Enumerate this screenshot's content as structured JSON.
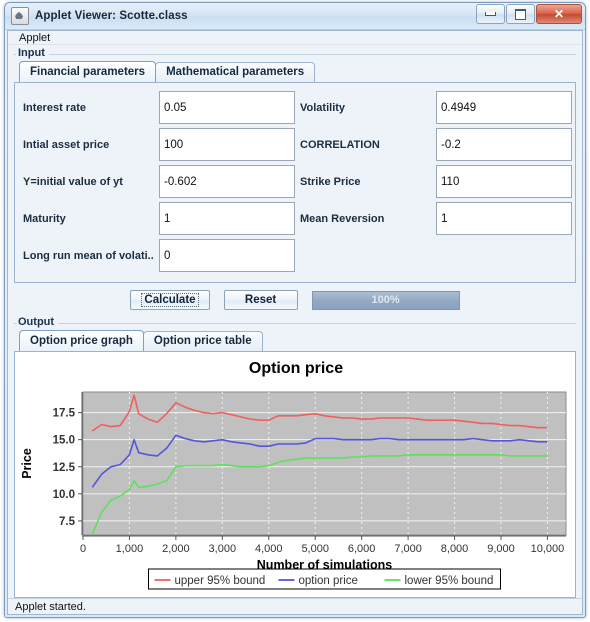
{
  "window": {
    "title": "Applet Viewer: Scotte.class",
    "icon": "java-cup-icon",
    "buttons": {
      "minimize": "minimize-icon",
      "maximize": "maximize-icon",
      "close": "✕"
    }
  },
  "menubar": {
    "applet_menu": "Applet"
  },
  "input_panel": {
    "title": "Input",
    "tabs": [
      {
        "label": "Financial parameters",
        "active": true
      },
      {
        "label": "Mathematical parameters",
        "active": false
      }
    ],
    "fields": [
      {
        "label": "Interest rate",
        "value": "0.05"
      },
      {
        "label": "Volatility",
        "value": "0.4949"
      },
      {
        "label": "Intial asset price",
        "value": "100"
      },
      {
        "label": "CORRELATION",
        "value": "-0.2"
      },
      {
        "label": "Y=initial value of yt",
        "value": "-0.602"
      },
      {
        "label": "Strike Price",
        "value": "110"
      },
      {
        "label": "Maturity",
        "value": "1"
      },
      {
        "label": "Mean Reversion",
        "value": "1"
      },
      {
        "label": "Long run mean of volati...",
        "value": "0"
      }
    ],
    "actions": {
      "calculate": "Calculate",
      "reset": "Reset",
      "progress_label": "100%",
      "progress_value": 100
    }
  },
  "output_panel": {
    "title": "Output",
    "tabs": [
      {
        "label": "Option price graph",
        "active": true
      },
      {
        "label": "Option price table",
        "active": false
      }
    ]
  },
  "statusbar": {
    "text": "Applet started."
  },
  "colors": {
    "upper_bound": "#ee5f5f",
    "option_price": "#5555dd",
    "lower_bound": "#5ee05e",
    "plot_background": "#c0c0c0",
    "gridline": "#f2f2f2",
    "progress_fill": "#8fa8c2"
  },
  "chart_data": {
    "type": "line",
    "title": "Option price",
    "xlabel": "Number of simulations",
    "ylabel": "Price",
    "xlim": [
      0,
      10400
    ],
    "ylim": [
      6.2,
      19.4
    ],
    "xticks": [
      0,
      1000,
      2000,
      3000,
      4000,
      5000,
      6000,
      7000,
      8000,
      9000,
      10000
    ],
    "xticklabels": [
      "0",
      "1,000",
      "2,000",
      "3,000",
      "4,000",
      "5,000",
      "6,000",
      "7,000",
      "8,000",
      "9,000",
      "10,000"
    ],
    "yticks": [
      7.5,
      10.0,
      12.5,
      15.0,
      17.5
    ],
    "yticklabels": [
      "7.5",
      "10.0",
      "12.5",
      "15.0",
      "17.5"
    ],
    "grid": true,
    "legend_position": "bottom",
    "x": [
      200,
      400,
      600,
      800,
      1000,
      1100,
      1200,
      1400,
      1600,
      1800,
      2000,
      2200,
      2400,
      2600,
      2800,
      3000,
      3200,
      3400,
      3600,
      3800,
      4000,
      4200,
      4400,
      4600,
      4800,
      5000,
      5200,
      5400,
      5600,
      5800,
      6000,
      6200,
      6400,
      6600,
      6800,
      7000,
      7200,
      7400,
      7600,
      7800,
      8000,
      8200,
      8400,
      8600,
      8800,
      9000,
      9200,
      9400,
      9600,
      9800,
      10000
    ],
    "series": [
      {
        "name": "upper 95% bound",
        "color": "#ee5f5f",
        "values": [
          15.8,
          16.4,
          16.2,
          16.3,
          17.6,
          19.1,
          17.4,
          16.9,
          16.6,
          17.4,
          18.4,
          18.0,
          17.7,
          17.5,
          17.4,
          17.5,
          17.3,
          17.1,
          16.9,
          16.8,
          16.8,
          17.2,
          17.2,
          17.2,
          17.3,
          17.4,
          17.2,
          17.1,
          17.0,
          17.0,
          16.9,
          16.9,
          17.0,
          17.0,
          17.0,
          17.0,
          16.9,
          16.8,
          16.8,
          16.8,
          16.8,
          16.7,
          16.6,
          16.5,
          16.5,
          16.4,
          16.3,
          16.3,
          16.2,
          16.1,
          16.1
        ]
      },
      {
        "name": "option price",
        "color": "#5555dd",
        "values": [
          10.6,
          11.8,
          12.5,
          12.7,
          13.6,
          15.0,
          13.8,
          13.6,
          13.5,
          14.2,
          15.4,
          15.1,
          14.9,
          14.8,
          14.9,
          15.0,
          14.8,
          14.7,
          14.6,
          14.4,
          14.4,
          14.6,
          14.6,
          14.6,
          14.7,
          15.1,
          15.1,
          15.1,
          15.0,
          15.0,
          15.0,
          15.0,
          15.1,
          15.1,
          15.0,
          15.0,
          15.0,
          15.0,
          15.0,
          15.0,
          15.0,
          15.0,
          15.1,
          15.0,
          14.9,
          14.9,
          14.9,
          15.0,
          14.9,
          14.8,
          14.8
        ]
      },
      {
        "name": "lower 95% bound",
        "color": "#5ee05e",
        "values": [
          6.3,
          8.3,
          9.4,
          9.8,
          10.4,
          11.2,
          10.6,
          10.7,
          10.9,
          11.2,
          12.5,
          12.6,
          12.6,
          12.6,
          12.6,
          12.7,
          12.6,
          12.5,
          12.5,
          12.5,
          12.6,
          12.9,
          13.1,
          13.2,
          13.3,
          13.3,
          13.3,
          13.3,
          13.3,
          13.4,
          13.4,
          13.5,
          13.5,
          13.5,
          13.5,
          13.6,
          13.6,
          13.6,
          13.6,
          13.6,
          13.6,
          13.6,
          13.6,
          13.6,
          13.6,
          13.6,
          13.5,
          13.5,
          13.5,
          13.5,
          13.5
        ]
      }
    ],
    "legend": [
      {
        "label": "upper 95% bound",
        "color": "#ee5f5f"
      },
      {
        "label": "option price",
        "color": "#5555dd"
      },
      {
        "label": "lower 95% bound",
        "color": "#5ee05e"
      }
    ]
  }
}
